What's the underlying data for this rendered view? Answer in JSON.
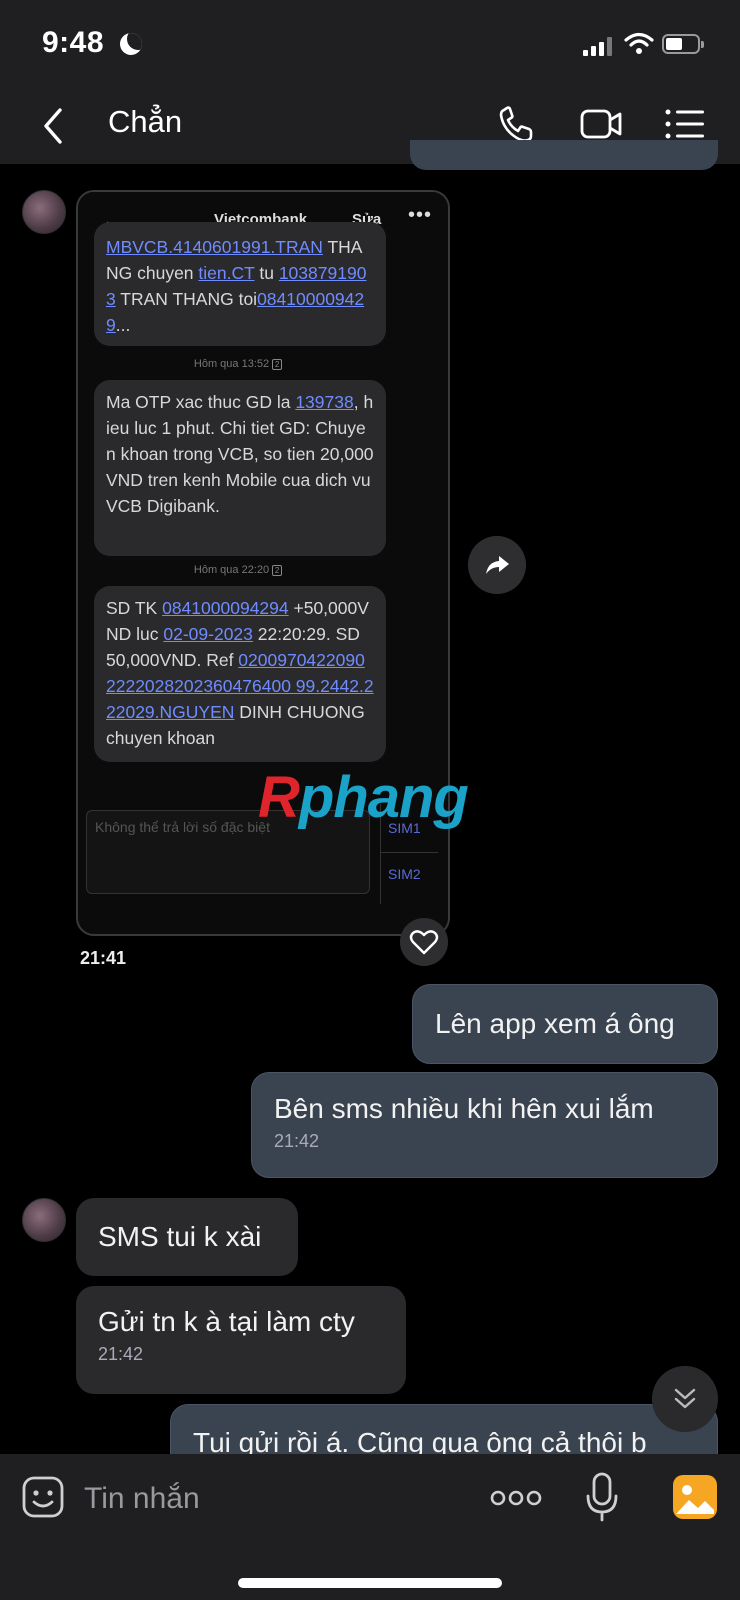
{
  "status_bar": {
    "time": "9:48"
  },
  "header": {
    "title": "Chẳn"
  },
  "screenshot": {
    "app_title": "Vietcombank",
    "edit_label": "Sửa",
    "messages": [
      {
        "parts": [
          {
            "text": "MBVCB.4140601991.TRAN",
            "link": true
          },
          {
            "text": " THANG chuyen ",
            "link": false
          },
          {
            "text": "tien.CT",
            "link": true
          },
          {
            "text": " tu ",
            "link": false
          },
          {
            "text": "1038791903",
            "link": true
          },
          {
            "text": " TRAN THANG toi",
            "link": false
          },
          {
            "text": "084100009429",
            "link": true
          },
          {
            "text": "...",
            "link": false
          }
        ]
      },
      {
        "parts": [
          {
            "text": "Ma OTP xac thuc GD la ",
            "link": false
          },
          {
            "text": "139738",
            "link": true
          },
          {
            "text": ", hieu luc 1 phut. Chi tiet GD: Chuyen khoan trong VCB, so tien 20,000 VND tren kenh Mobile cua dich vu VCB Digibank.",
            "link": false
          }
        ]
      },
      {
        "parts": [
          {
            "text": "SD TK ",
            "link": false
          },
          {
            "text": "0841000094294",
            "link": true
          },
          {
            "text": " +50,000VND luc ",
            "link": false
          },
          {
            "text": "02-09-2023",
            "link": true
          },
          {
            "text": " 22:20:29. SD 50,000VND. Ref ",
            "link": false
          },
          {
            "text": "02009704220902222028202360476400 99.2442.222029.NGUYEN",
            "link": true
          },
          {
            "text": " DINH CHUONG chuyen khoan",
            "link": false
          }
        ]
      }
    ],
    "timestamps": [
      "Hôm qua 13:52",
      "Hôm qua 22:20"
    ],
    "sim_badge": "2",
    "reply_disabled_text": "Không thể trả lời số đặc biệt",
    "sim1_label": "SIM1",
    "sim2_label": "SIM2"
  },
  "watermark": {
    "part1": "R",
    "part2": "phang"
  },
  "chat": {
    "image_time": "21:41",
    "messages": [
      {
        "text": "Lên app xem á ông",
        "direction": "out",
        "time": ""
      },
      {
        "text": "Bên sms nhiều khi hên xui lắm",
        "direction": "out",
        "time": "21:42"
      },
      {
        "text": "SMS tui k xài",
        "direction": "in",
        "time": ""
      },
      {
        "text": "Gửi tn k à tại làm cty",
        "direction": "in",
        "time": "21:42"
      },
      {
        "text": "Tui gửi rồi á. Cũng qua ông cả thôi b",
        "direction": "out",
        "time": ""
      }
    ]
  },
  "composer": {
    "placeholder": "Tin nhắn"
  },
  "colors": {
    "accent_link": "#6f8cff",
    "outgoing_bubble": "#3a4350",
    "incoming_bubble": "#2a2a2c",
    "gallery_icon": "#f5a623"
  }
}
